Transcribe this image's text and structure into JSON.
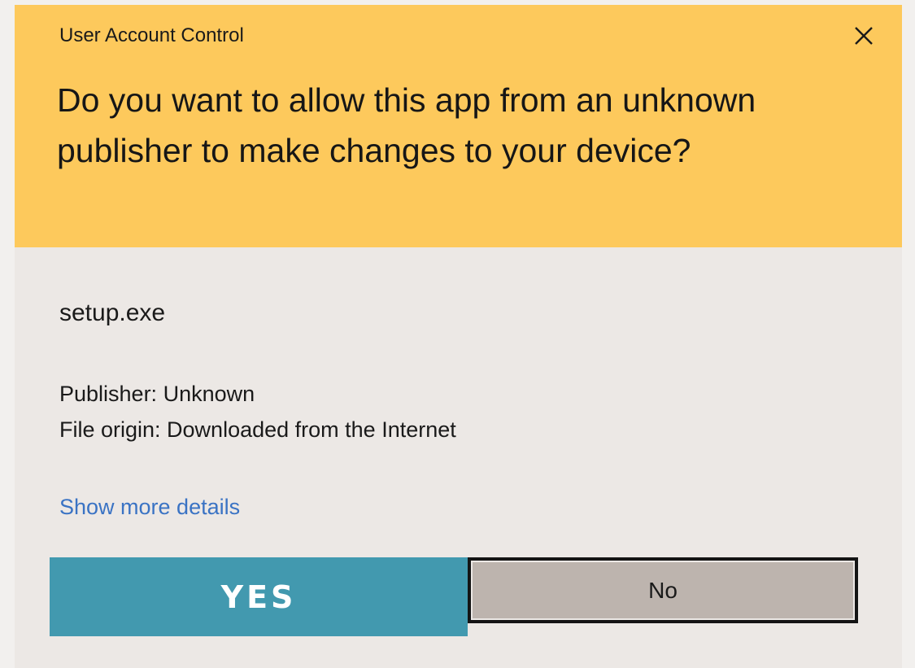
{
  "dialog": {
    "window_title": "User Account Control",
    "question": "Do you want to allow this app from an unknown publisher to make changes to your device?",
    "app_name": "setup.exe",
    "publisher_line": "Publisher: Unknown",
    "origin_line": "File origin: Downloaded from the Internet",
    "details_link": "Show more details",
    "yes_label": "YES",
    "no_label": "No",
    "close_icon": "close-icon"
  },
  "colors": {
    "header_bg": "#fdc95c",
    "body_bg": "#ece8e5",
    "yes_bg": "#4299af",
    "no_bg": "#bdb4ae",
    "link": "#3a73c4"
  }
}
